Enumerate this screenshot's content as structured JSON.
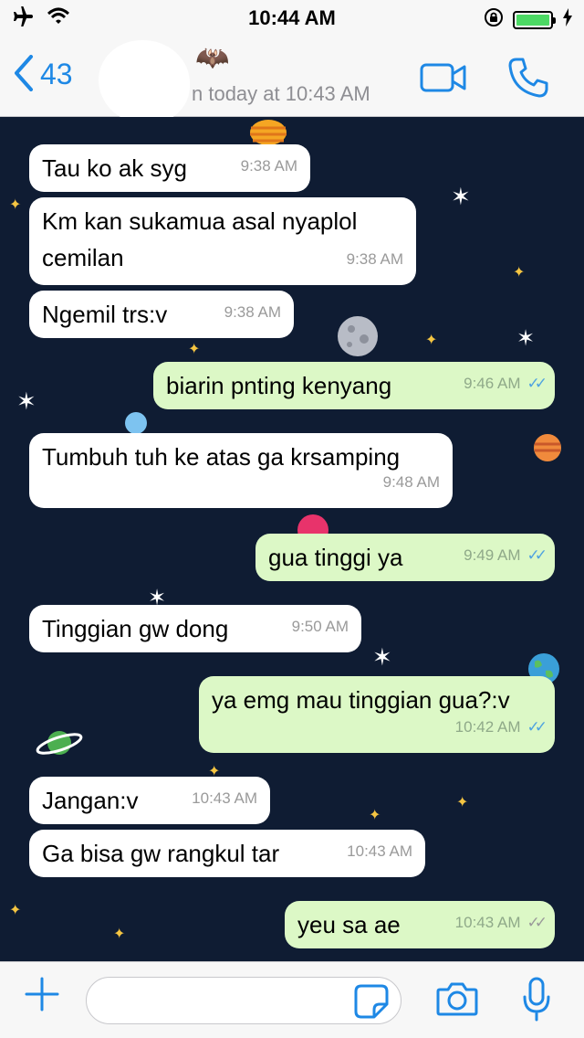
{
  "status_bar": {
    "time": "10:44 AM"
  },
  "header": {
    "back_count": "43",
    "last_seen": "n today at 10:43 AM",
    "contact_emoji": "🦇"
  },
  "messages": [
    {
      "direction": "in",
      "text": "Tau ko ak syg",
      "time": "9:38 AM"
    },
    {
      "direction": "in",
      "text": "Km kan sukamua asal nyaplol cemilan",
      "time": "9:38 AM"
    },
    {
      "direction": "in",
      "text": "Ngemil trs:v",
      "time": "9:38 AM"
    },
    {
      "direction": "out",
      "text": "biarin pnting kenyang",
      "time": "9:46 AM",
      "ticks": "read"
    },
    {
      "direction": "in",
      "text": "Tumbuh tuh ke atas ga krsamping",
      "time": "9:48 AM"
    },
    {
      "direction": "out",
      "text": "gua tinggi ya",
      "time": "9:49 AM",
      "ticks": "read"
    },
    {
      "direction": "in",
      "text": "Tinggian gw dong",
      "time": "9:50 AM"
    },
    {
      "direction": "out",
      "text": "ya emg mau tinggian gua?:v",
      "time": "10:42 AM",
      "ticks": "read"
    },
    {
      "direction": "in",
      "text": "Jangan:v",
      "time": "10:43 AM"
    },
    {
      "direction": "in",
      "text": "Ga bisa gw rangkul tar",
      "time": "10:43 AM"
    },
    {
      "direction": "out",
      "text": "yeu sa ae",
      "time": "10:43 AM",
      "ticks": "delivered"
    }
  ],
  "icons": {
    "status_left": [
      "airplane-icon",
      "wifi-icon"
    ],
    "status_right": [
      "orientation-lock-icon",
      "battery-icon",
      "charging-icon"
    ],
    "header": [
      "back-chevron-icon",
      "video-call-icon",
      "phone-call-icon"
    ],
    "input": [
      "plus-icon",
      "sticker-icon",
      "camera-icon",
      "microphone-icon"
    ]
  },
  "colors": {
    "accent": "#1e88e5",
    "outgoing_bubble": "#dcf8c6",
    "incoming_bubble": "#ffffff",
    "chat_background": "#0f1c33",
    "read_tick": "#4fa3e0",
    "battery": "#4cd964"
  },
  "input": {
    "placeholder": ""
  }
}
